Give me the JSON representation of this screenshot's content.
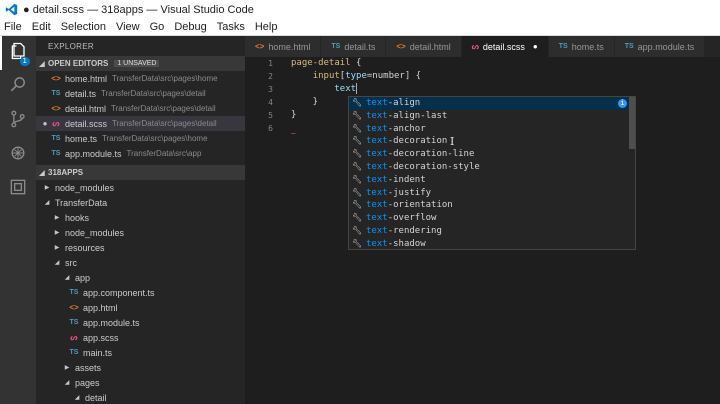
{
  "window": {
    "title": "● detail.scss — 318apps — Visual Studio Code"
  },
  "menu": [
    "File",
    "Edit",
    "Selection",
    "View",
    "Go",
    "Debug",
    "Tasks",
    "Help"
  ],
  "activity": {
    "badge": "1"
  },
  "explorer": {
    "title": "EXPLORER",
    "open_editors": {
      "label": "OPEN EDITORS",
      "count": "1 UNSAVED",
      "items": [
        {
          "icon": "html",
          "name": "home.html",
          "path": "TransferData\\src\\pages\\home"
        },
        {
          "icon": "ts",
          "name": "detail.ts",
          "path": "TransferData\\src\\pages\\detail"
        },
        {
          "icon": "html",
          "name": "detail.html",
          "path": "TransferData\\src\\pages\\detail"
        },
        {
          "icon": "scss",
          "name": "detail.scss",
          "path": "TransferData\\src\\pages\\detail",
          "dirty": "●"
        },
        {
          "icon": "ts",
          "name": "home.ts",
          "path": "TransferData\\src\\pages\\home"
        },
        {
          "icon": "ts",
          "name": "app.module.ts",
          "path": "TransferData\\src\\app"
        }
      ]
    },
    "project": {
      "label": "318APPS",
      "tree": [
        {
          "name": "node_modules",
          "chev": "▶",
          "depth": 0
        },
        {
          "name": "TransferData",
          "chev": "◢",
          "depth": 0
        },
        {
          "name": "hooks",
          "chev": "▶",
          "depth": 1
        },
        {
          "name": "node_modules",
          "chev": "▶",
          "depth": 1
        },
        {
          "name": "resources",
          "chev": "▶",
          "depth": 1
        },
        {
          "name": "src",
          "chev": "◢",
          "depth": 1
        },
        {
          "name": "app",
          "chev": "◢",
          "depth": 2
        },
        {
          "name": "app.component.ts",
          "icon": "ts",
          "depth": 3
        },
        {
          "name": "app.html",
          "icon": "html",
          "depth": 3
        },
        {
          "name": "app.module.ts",
          "icon": "ts",
          "depth": 3
        },
        {
          "name": "app.scss",
          "icon": "scss",
          "depth": 3
        },
        {
          "name": "main.ts",
          "icon": "ts",
          "depth": 3
        },
        {
          "name": "assets",
          "chev": "▶",
          "depth": 2
        },
        {
          "name": "pages",
          "chev": "◢",
          "depth": 2
        },
        {
          "name": "detail",
          "chev": "◢",
          "depth": 3
        }
      ]
    }
  },
  "tabs": [
    {
      "icon": "html",
      "label": "home.html"
    },
    {
      "icon": "ts",
      "label": "detail.ts"
    },
    {
      "icon": "html",
      "label": "detail.html"
    },
    {
      "icon": "scss",
      "label": "detail.scss",
      "active": true,
      "dirty": "●"
    },
    {
      "icon": "ts",
      "label": "home.ts"
    },
    {
      "icon": "ts",
      "label": "app.module.ts"
    }
  ],
  "editor": {
    "line_numbers": [
      "1",
      "2",
      "3",
      "4",
      "5",
      "6"
    ],
    "lines": {
      "l1_sel": "page-detail",
      "l1_rest": " {",
      "l2_indent": "    ",
      "l2_tag": "input",
      "l2_attr_open": "[",
      "l2_attr": "type",
      "l2_eq": "=number",
      "l2_rest": "] {",
      "l3_indent": "        ",
      "l3_text": "text",
      "l4": "    }",
      "l5": "}",
      "l6": ""
    },
    "error_marker": "~"
  },
  "suggest": {
    "prefix": "text",
    "items": [
      {
        "prefix": "text",
        "rest": "-align",
        "focused": true
      },
      {
        "prefix": "text",
        "rest": "-align-last"
      },
      {
        "prefix": "text",
        "rest": "-anchor"
      },
      {
        "prefix": "text",
        "rest": "-decoration"
      },
      {
        "prefix": "text",
        "rest": "-decoration-line"
      },
      {
        "prefix": "text",
        "rest": "-decoration-style"
      },
      {
        "prefix": "text",
        "rest": "-indent"
      },
      {
        "prefix": "text",
        "rest": "-justify"
      },
      {
        "prefix": "text",
        "rest": "-orientation"
      },
      {
        "prefix": "text",
        "rest": "-overflow"
      },
      {
        "prefix": "text",
        "rest": "-rendering"
      },
      {
        "prefix": "text",
        "rest": "-shadow"
      }
    ],
    "info_glyph": "i"
  },
  "colors": {
    "accent": "#007acc",
    "match_highlight": "#0097fb",
    "focused_row": "#062f4a"
  }
}
